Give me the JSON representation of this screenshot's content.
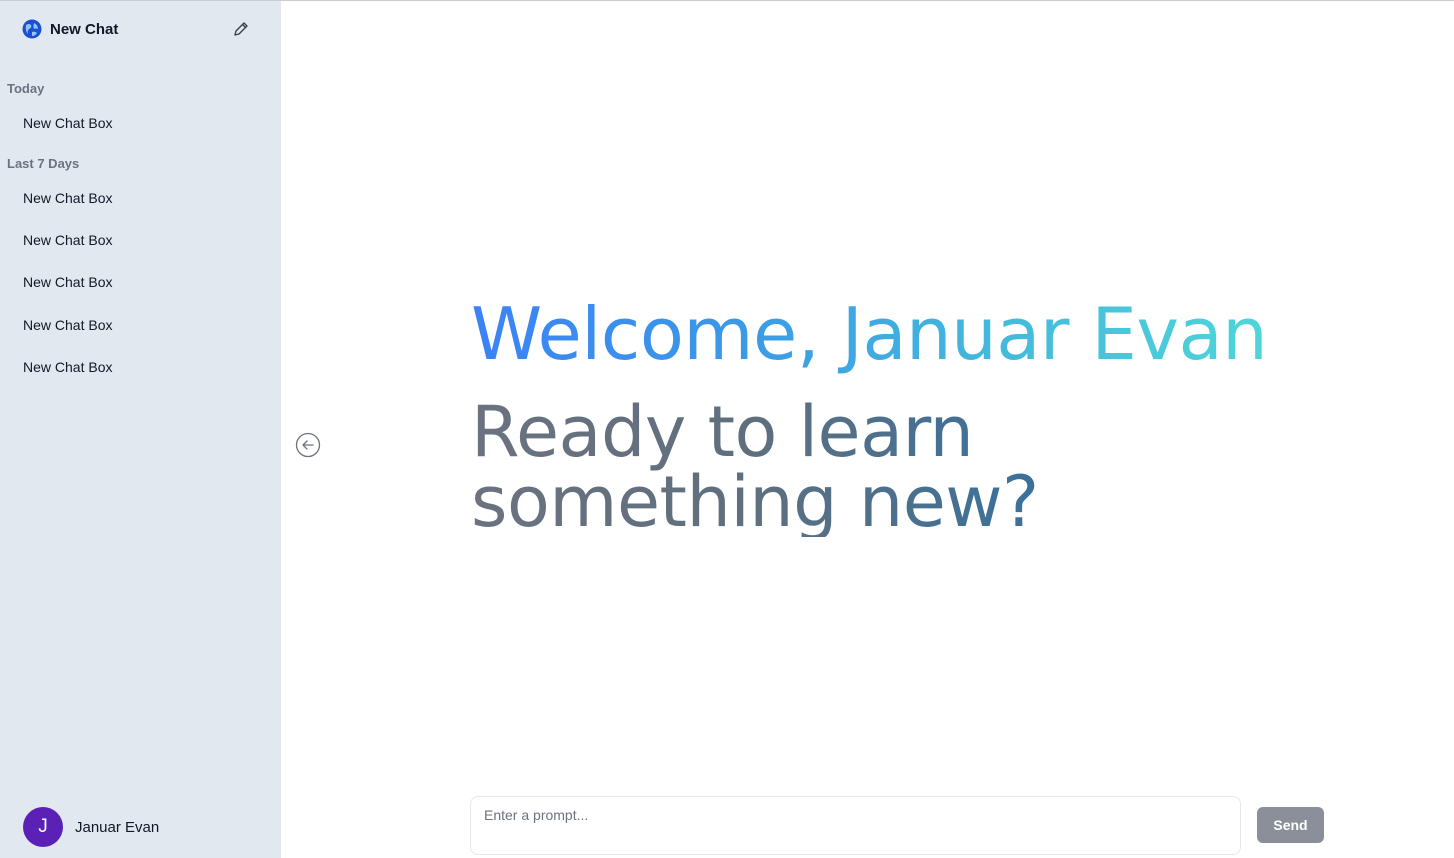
{
  "sidebar": {
    "title": "New Chat",
    "groups": [
      {
        "label": "Today",
        "items": [
          "New Chat Box"
        ]
      },
      {
        "label": "Last 7 Days",
        "items": [
          "New Chat Box",
          "New Chat Box",
          "New Chat Box",
          "New Chat Box",
          "New Chat Box"
        ]
      }
    ],
    "user": {
      "initial": "J",
      "name": "Januar Evan"
    }
  },
  "main": {
    "welcome": "Welcome, Januar Evan",
    "tagline_line1": "Ready to learn",
    "tagline_line2": "something new?",
    "prompt_placeholder": "Enter a prompt...",
    "send_label": "Send"
  },
  "icons": {
    "logo": "globe-logo-icon",
    "edit": "pencil-icon",
    "collapse": "arrow-left-circle-icon"
  },
  "colors": {
    "sidebar_bg": "#e2e8f0",
    "avatar_bg": "#5b21b6",
    "send_bg": "#8a8f99",
    "welcome_gradient_start": "#3b82f6",
    "welcome_gradient_end": "#4fd6d8"
  }
}
